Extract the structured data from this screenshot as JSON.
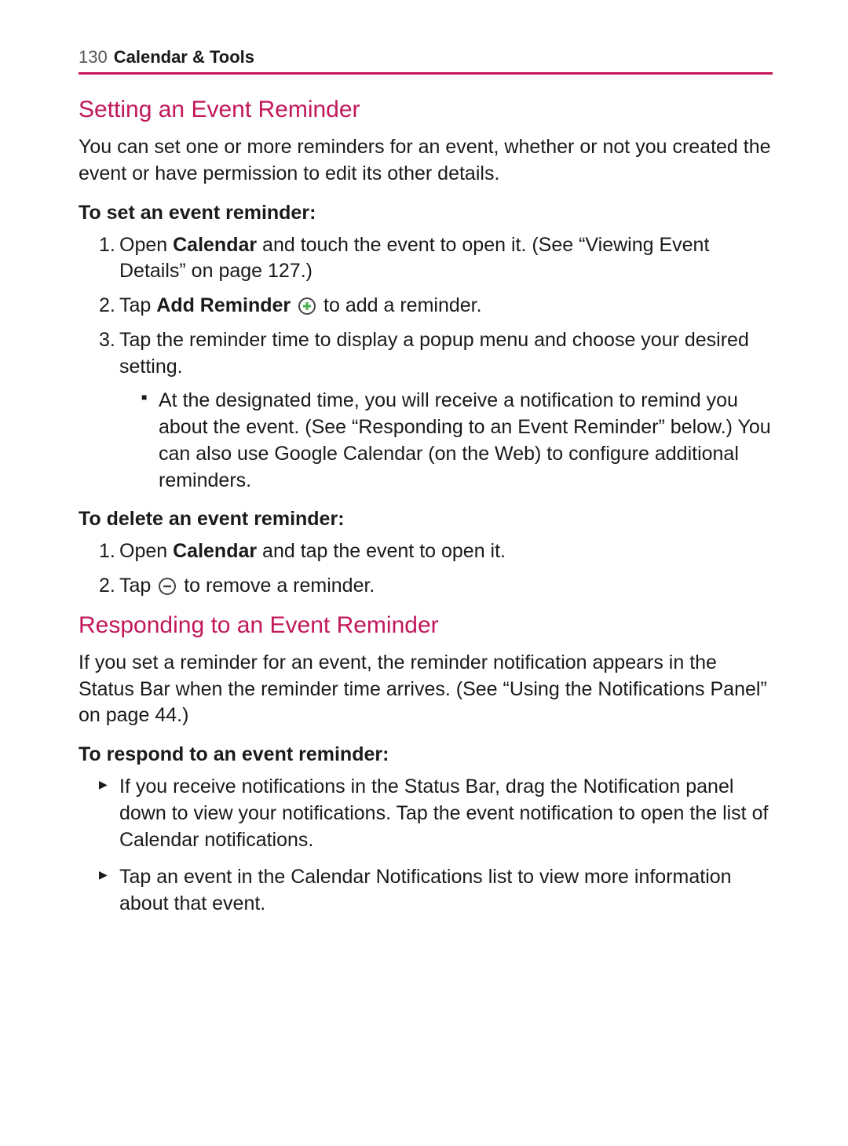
{
  "header": {
    "page_number": "130",
    "title": "Calendar & Tools"
  },
  "section1": {
    "heading": "Setting an Event Reminder",
    "intro": "You can set one or more reminders for an event, whether or not you created the event or have permission to edit its other details.",
    "sub1": {
      "title": "To set an event reminder:",
      "step1_a": "Open ",
      "step1_b": "Calendar",
      "step1_c": " and touch the event to open it. (See “Viewing Event Details” on page 127.)",
      "step2_a": "Tap ",
      "step2_b": "Add Reminder",
      "step2_c": " to add a reminder.",
      "step3": "Tap the reminder time to display a popup menu and choose your desired setting.",
      "step3_bullet": "At the designated time, you will receive a notification to remind you about the event. (See “Responding to an Event Reminder” below.) You can also use Google Calendar (on the Web) to configure additional reminders."
    },
    "sub2": {
      "title": "To delete an event reminder:",
      "step1_a": "Open ",
      "step1_b": "Calendar",
      "step1_c": " and tap the event to open it.",
      "step2_a": "Tap ",
      "step2_b": " to remove a reminder."
    }
  },
  "section2": {
    "heading": "Responding to an Event Reminder",
    "intro": "If you set a reminder for an event, the reminder notification appears in the Status Bar when the reminder time arrives. (See “Using the Notifications Panel” on page 44.)",
    "sub1": {
      "title": "To respond to an event reminder:",
      "bullet1": "If you receive notifications in the Status Bar, drag the Notification panel down to view your notifications. Tap the event notification to open the list of Calendar notifications.",
      "bullet2": "Tap an event in the Calendar Notifications list to view more information about that event."
    }
  }
}
